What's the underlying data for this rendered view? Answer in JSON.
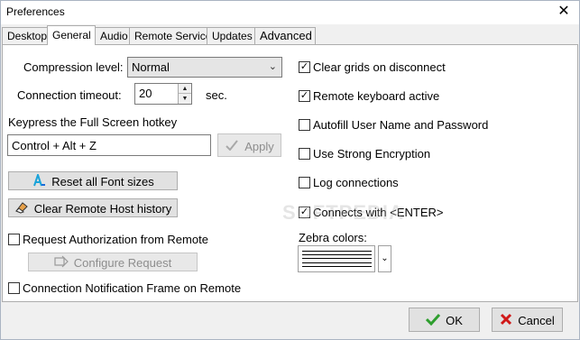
{
  "window": {
    "title": "Preferences",
    "close_glyph": "✕"
  },
  "tabs": [
    {
      "label": "Desktop"
    },
    {
      "label": "General"
    },
    {
      "label": "Audio"
    },
    {
      "label": "Remote Service"
    },
    {
      "label": "Updates"
    },
    {
      "label": "Advanced"
    }
  ],
  "general": {
    "compression_label": "Compression level:",
    "compression_value": "Normal",
    "timeout_label": "Connection timeout:",
    "timeout_value": "20",
    "timeout_unit": "sec.",
    "hotkey_heading": "Keypress the Full Screen hotkey",
    "hotkey_value": "Control + Alt + Z",
    "apply_label": "Apply",
    "reset_fonts_label": "Reset all Font sizes",
    "clear_history_label": "Clear Remote Host history",
    "request_auth_label": "Request Authorization from Remote",
    "configure_request_label": "Configure Request",
    "notification_frame_label": "Connection Notification Frame on Remote"
  },
  "options": [
    {
      "label": "Clear grids on disconnect",
      "checked": true
    },
    {
      "label": "Remote keyboard active",
      "checked": true
    },
    {
      "label": "Autofill User Name and Password",
      "checked": false
    },
    {
      "label": "Use Strong Encryption",
      "checked": false
    },
    {
      "label": "Log connections",
      "checked": false
    },
    {
      "label": "Connects with <ENTER>",
      "checked": true
    }
  ],
  "zebra": {
    "label": "Zebra colors:"
  },
  "watermark": "SOFTPEDIA",
  "footer": {
    "ok_label": "OK",
    "cancel_label": "Cancel"
  },
  "colors": {
    "ok_icon": "#2e9e2e",
    "cancel_icon": "#d01818",
    "disabled_text": "#8d8d8d"
  }
}
